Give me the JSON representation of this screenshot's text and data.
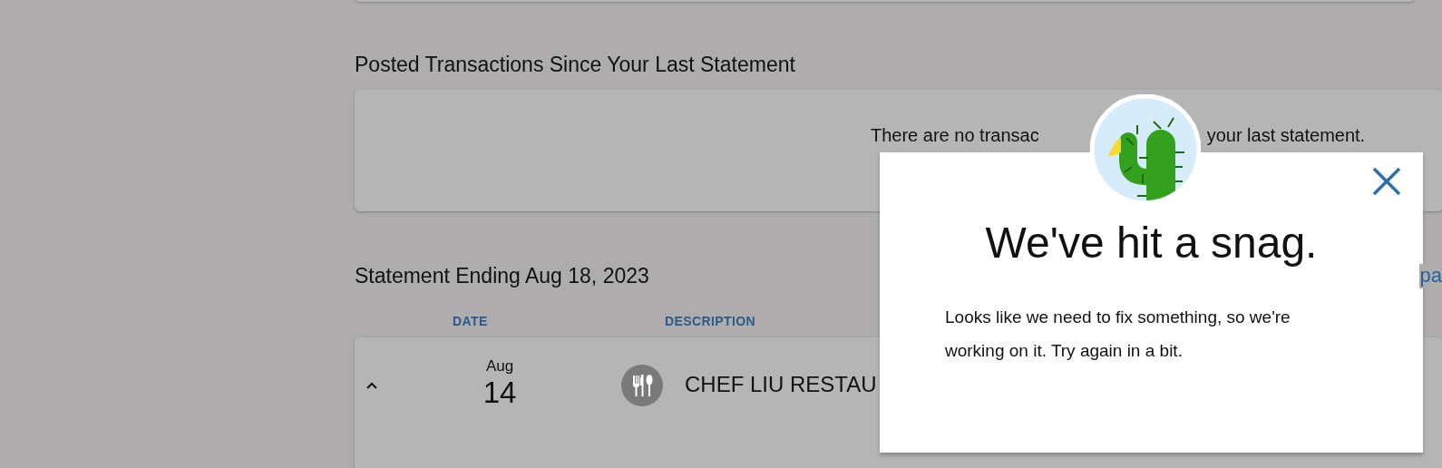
{
  "posted_section": {
    "title": "Posted Transactions Since Your Last Statement",
    "message_parts": [
      "There are no transac",
      "your last statement."
    ]
  },
  "statement": {
    "title": "Statement Ending Aug 18, 2023",
    "link": "pa",
    "columns": [
      "DATE",
      "DESCRIPTION"
    ],
    "rows": [
      {
        "expanded": true,
        "month": "Aug",
        "day": "14",
        "description": "CHEF LIU RESTAU"
      }
    ]
  },
  "dialog": {
    "title": "We've hit a snag.",
    "body": "Looks like we need to fix something, so we're working on it. Try again in a bit."
  }
}
